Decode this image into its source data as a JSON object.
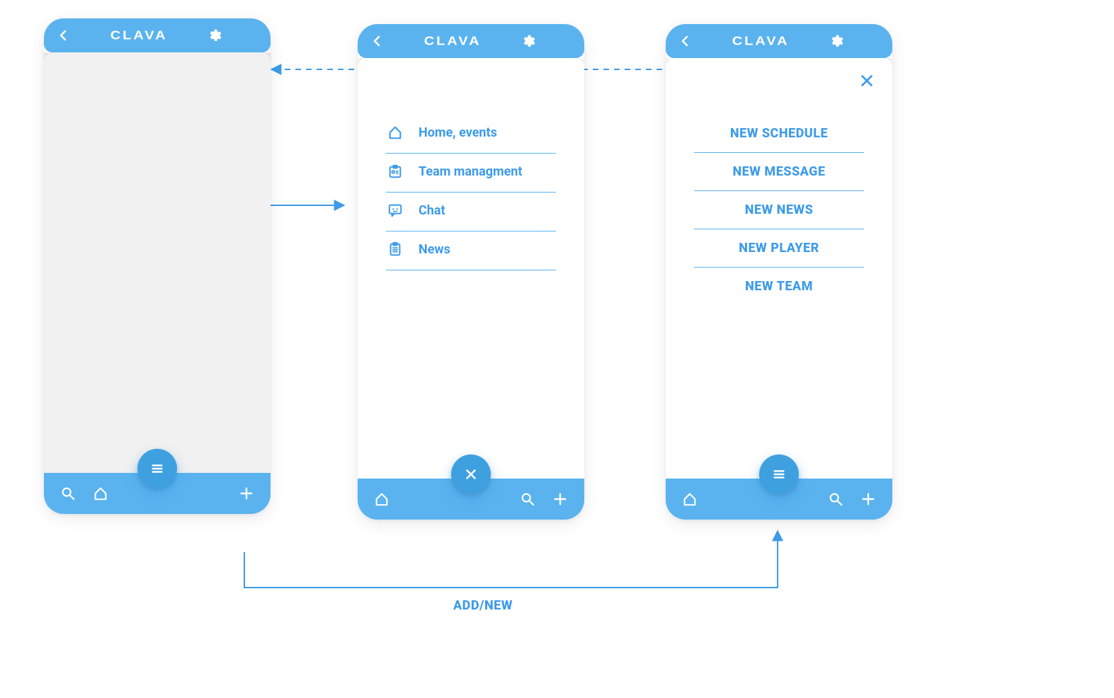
{
  "app": {
    "brand": "CLAVA"
  },
  "screen2": {
    "menu": [
      {
        "icon": "home-icon",
        "label": "Home, events"
      },
      {
        "icon": "team-icon",
        "label": "Team managment"
      },
      {
        "icon": "chat-icon",
        "label": "Chat"
      },
      {
        "icon": "news-icon",
        "label": "News"
      }
    ]
  },
  "screen3": {
    "actions": [
      "NEW SCHEDULE",
      "NEW MESSAGE",
      "NEW NEWS",
      "NEW PLAYER",
      "NEW TEAM"
    ]
  },
  "flow": {
    "bottom_label": "ADD/NEW"
  }
}
